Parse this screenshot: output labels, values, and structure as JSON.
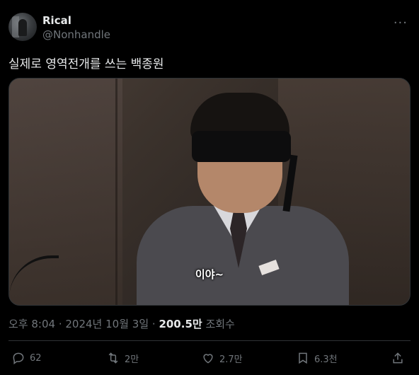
{
  "author": {
    "name": "Rical",
    "handle": "@Nonhandle",
    "more_icon": "more-dots-icon"
  },
  "tweet": {
    "text": "실제로 영역전개를 쓰는 백종원",
    "media_caption": "이야~"
  },
  "meta": {
    "time": "오후 8:04",
    "sep1": " · ",
    "date": "2024년 10월 3일",
    "sep2": " · ",
    "views": "200.5만",
    "views_label": " 조회수"
  },
  "actions": {
    "reply": {
      "icon": "reply-icon",
      "count": "62"
    },
    "retweet": {
      "icon": "retweet-icon",
      "count": "2만"
    },
    "like": {
      "icon": "heart-icon",
      "count": "2.7만"
    },
    "bookmark": {
      "icon": "bookmark-icon",
      "count": "6.3천"
    },
    "share": {
      "icon": "share-icon"
    }
  },
  "colors": {
    "background": "#000000",
    "text": "#e7e9ea",
    "muted": "#71767b",
    "border": "#2f3336"
  }
}
